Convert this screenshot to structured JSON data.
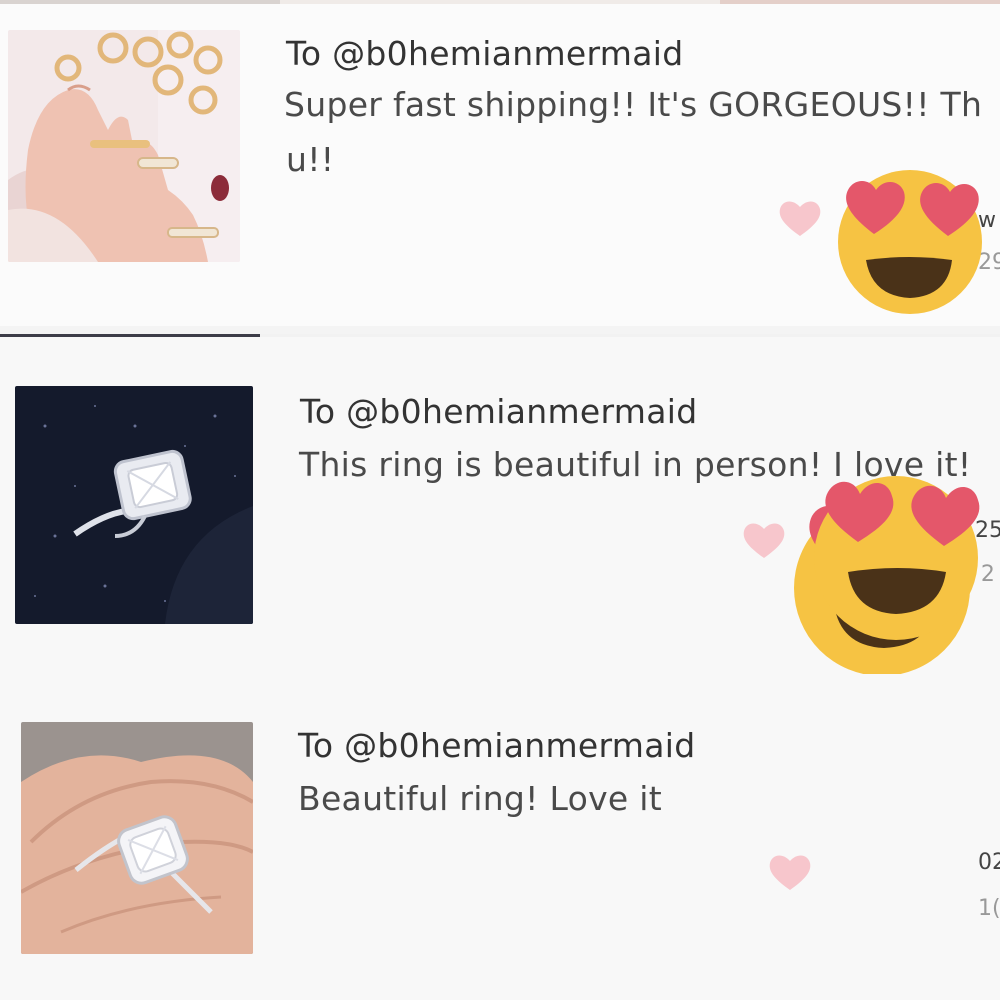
{
  "reviews": [
    {
      "to": "To @b0hemianmermaid",
      "text_line1": "Super fast shipping!! It's GORGEOUS!! Th",
      "text_line2": "u!!",
      "thumb_icon": "rose-gold-rings-photo",
      "meta_top": "w",
      "meta_bottom": "29",
      "emoji": "heart-eyes-face"
    },
    {
      "to": "To @b0hemianmermaid",
      "text_line1": "This ring is beautiful in person! I love it!",
      "text_line2": "",
      "thumb_icon": "cushion-cut-diamond-ring-photo",
      "meta_top": "25",
      "meta_bottom": "h 2",
      "emoji": "heart-eyes-face"
    },
    {
      "to": "To @b0hemianmermaid",
      "text_line1": "Beautiful ring! Love it",
      "text_line2": "",
      "thumb_icon": "diamond-ring-on-hand-photo",
      "meta_top": "02",
      "meta_bottom": "1(",
      "emoji": "heart-eyes-face"
    }
  ],
  "colors": {
    "like_heart": "#f7c6cc",
    "emoji_face": "#f6c343",
    "emoji_hearts": "#e4576a",
    "emoji_mouth": "#4a3218"
  }
}
